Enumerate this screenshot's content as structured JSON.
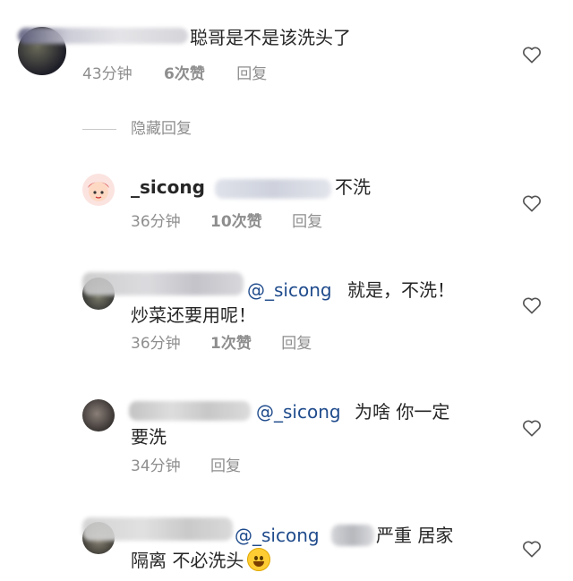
{
  "comment_1": {
    "text": "聪哥是不是该洗头了",
    "time": "43分钟",
    "likes": "6次赞",
    "reply": "回复"
  },
  "hide_replies": "隐藏回复",
  "reply_1": {
    "username": "_sicong",
    "text": "不洗",
    "time": "36分钟",
    "likes": "10次赞",
    "reply": "回复"
  },
  "reply_2": {
    "mention": "@_sicong",
    "text_line1": "就是，不洗！",
    "text_line2": "炒菜还要用呢！",
    "time": "36分钟",
    "likes": "1次赞",
    "reply": "回复"
  },
  "reply_3": {
    "mention": "@_sicong",
    "text_line1": "为啥 你一定",
    "text_line2": "要洗",
    "time": "34分钟",
    "reply": "回复"
  },
  "reply_4": {
    "mention": "@_sicong",
    "text_line1": "严重 居家",
    "text_line2": "隔离 不必洗头",
    "emoji": "smiling-face-emoji"
  },
  "icons": {
    "heart": "heart-outline-icon"
  },
  "colors": {
    "mention": "#1f4b8c",
    "meta": "#8e8e8e",
    "text": "#262626"
  }
}
